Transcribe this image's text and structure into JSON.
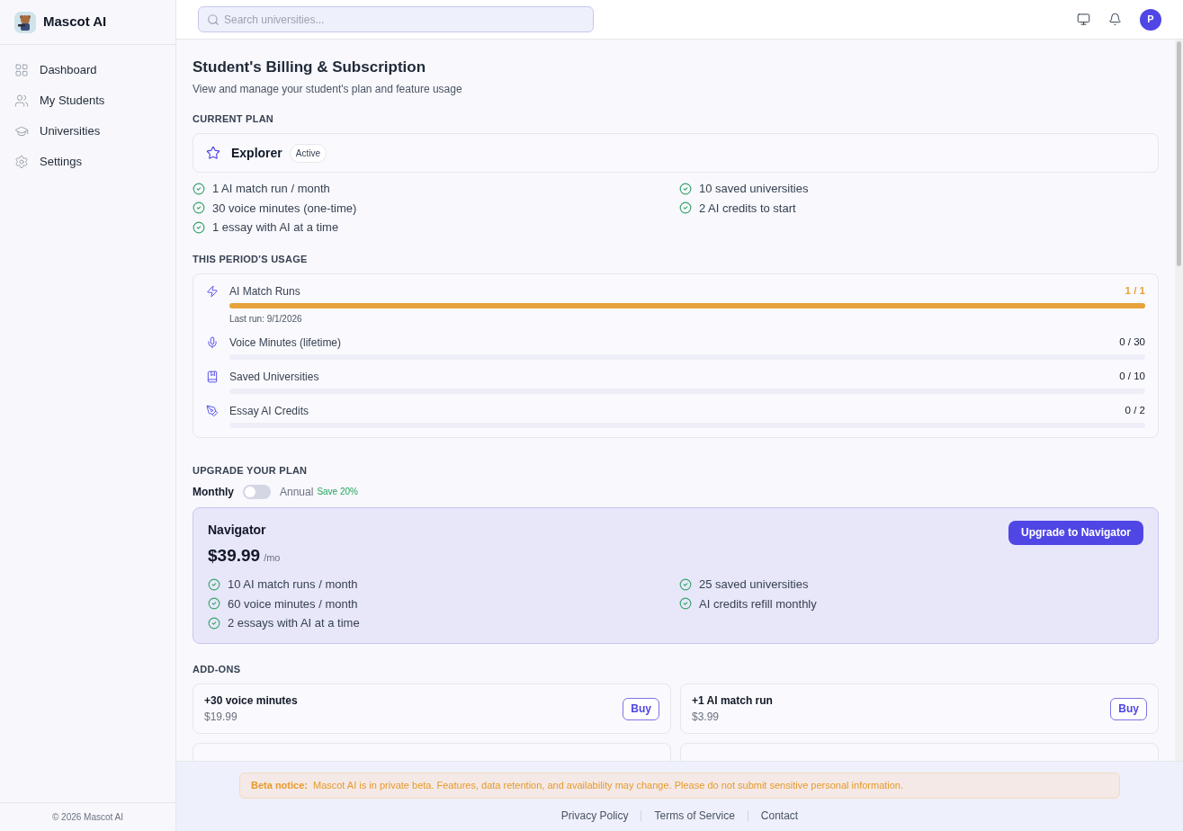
{
  "brand": {
    "name": "Mascot AI"
  },
  "sidebar": {
    "items": [
      {
        "label": "Dashboard",
        "selected": false
      },
      {
        "label": "My Students",
        "selected": false
      },
      {
        "label": "Universities",
        "selected": false
      },
      {
        "label": "Settings",
        "selected": false
      }
    ],
    "footer": "© 2026 Mascot AI"
  },
  "search": {
    "placeholder": "Search universities..."
  },
  "avatar": "P",
  "page": {
    "title": "Student's Billing & Subscription",
    "subtitle": "View and manage your student's plan and feature usage"
  },
  "current_plan": {
    "heading": "CURRENT PLAN",
    "name": "Explorer",
    "badge": "Active",
    "features_left": [
      "1 AI match run / month",
      "30 voice minutes (one-time)",
      "1 essay with AI at a time"
    ],
    "features_right": [
      "10 saved universities",
      "2 AI credits to start"
    ]
  },
  "usage": {
    "heading": "THIS PERIOD'S USAGE",
    "meters": [
      {
        "label": "AI Match Runs",
        "reading": "1 / 1",
        "level": 1,
        "note": "Last run: 9/1/2026"
      },
      {
        "label": "Voice Minutes (lifetime)",
        "reading": "0 / 30",
        "level": 0
      },
      {
        "label": "Saved Universities",
        "reading": "0 / 10",
        "level": 0
      },
      {
        "label": "Essay AI Credits",
        "reading": "0 / 2",
        "level": 0
      }
    ]
  },
  "upgrade": {
    "heading": "UPGRADE YOUR PLAN",
    "monthly": "Monthly",
    "annual": "Annual",
    "save": "Save 20%",
    "annual_on": false,
    "plan": {
      "name": "Navigator",
      "price": "$39.99",
      "period": "/mo",
      "button": "Upgrade to Navigator",
      "features_left": [
        "10 AI match runs / month",
        "60 voice minutes / month",
        "2 essays with AI at a time"
      ],
      "features_right": [
        "25 saved universities",
        "AI credits refill monthly"
      ]
    }
  },
  "addons": {
    "heading": "ADD-ONS",
    "items": [
      {
        "name": "+30 voice minutes",
        "price": "$19.99",
        "button": "Buy"
      },
      {
        "name": "+1 AI match run",
        "price": "$3.99",
        "button": "Buy"
      }
    ]
  },
  "notice": {
    "label": "Beta notice:",
    "text": "Mascot AI is in private beta. Features, data retention, and availability may change. Please do not submit sensitive personal information."
  },
  "footer_links": [
    "Privacy Policy",
    "Terms of Service",
    "Contact"
  ]
}
